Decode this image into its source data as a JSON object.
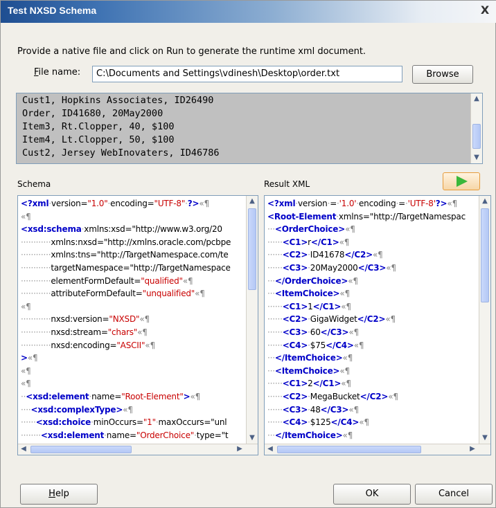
{
  "window": {
    "title": "Test NXSD Schema",
    "close_glyph": "X"
  },
  "instruction": "Provide a native file and click on Run to generate the runtime xml document.",
  "file": {
    "label_prefix": "F",
    "label_rest": "ile name:",
    "value": "C:\\Documents and Settings\\vdinesh\\Desktop\\order.txt",
    "browse_label": "Browse"
  },
  "preview_lines": [
    "Cust1, Hopkins Associates, ID26490",
    "Order, ID41680, 20May2000",
    "Item3, Rt.Clopper, 40, $100",
    "Item4, Lt.Clopper, 50, $100",
    "Cust2, Jersey WebInovaters, ID46786"
  ],
  "schema": {
    "label": "Schema",
    "lines": [
      "<?xml·version=\"1.0\"·encoding=\"UTF-8\"·?>«¶",
      "«¶",
      "<xsd:schema·xmlns:xsd=\"http://www.w3.org/20",
      "············xmlns:nxsd=\"http://xmlns.oracle.com/pcbpe",
      "············xmlns:tns=\"http://TargetNamespace.com/te",
      "············targetNamespace=\"http://TargetNamespace",
      "············elementFormDefault=\"qualified\"«¶",
      "············attributeFormDefault=\"unqualified\"«¶",
      "«¶",
      "············nxsd:version=\"NXSD\"«¶",
      "············nxsd:stream=\"chars\"«¶",
      "············nxsd:encoding=\"ASCII\"«¶",
      ">«¶",
      "«¶",
      "«¶",
      "··<xsd:element·name=\"Root-Element\">«¶",
      "····<xsd:complexType>«¶",
      "······<xsd:choice·minOccurs=\"1\"·maxOccurs=\"unl",
      "········<xsd:element·name=\"OrderChoice\"·type=\"t"
    ]
  },
  "result": {
    "label": "Result XML",
    "lines": [
      "<?xml·version·=·'1.0'·encoding·=·'UTF-8'?>«¶",
      "<Root-Element·xmlns=\"http://TargetNamespac",
      "···<OrderChoice>«¶",
      "······<C1>r</C1>«¶",
      "······<C2>·ID41678</C2>«¶",
      "······<C3>·20May2000</C3>«¶",
      "···</OrderChoice>«¶",
      "···<ItemChoice>«¶",
      "······<C1>1</C1>«¶",
      "······<C2>·GigaWidget</C2>«¶",
      "······<C3>·60</C3>«¶",
      "······<C4>·$75</C4>«¶",
      "···</ItemChoice>«¶",
      "···<ItemChoice>«¶",
      "······<C1>2</C1>«¶",
      "······<C2>·MegaBucket</C2>«¶",
      "······<C3>·48</C3>«¶",
      "······<C4>·$125</C4>«¶",
      "···</ItemChoice>«¶"
    ]
  },
  "buttons": {
    "help_prefix": "H",
    "help_rest": "elp",
    "ok": "OK",
    "cancel": "Cancel"
  },
  "colors": {
    "run_icon": "#3ab83a",
    "tag": "#0000c8",
    "value": "#c80000",
    "attr": "#000080"
  }
}
